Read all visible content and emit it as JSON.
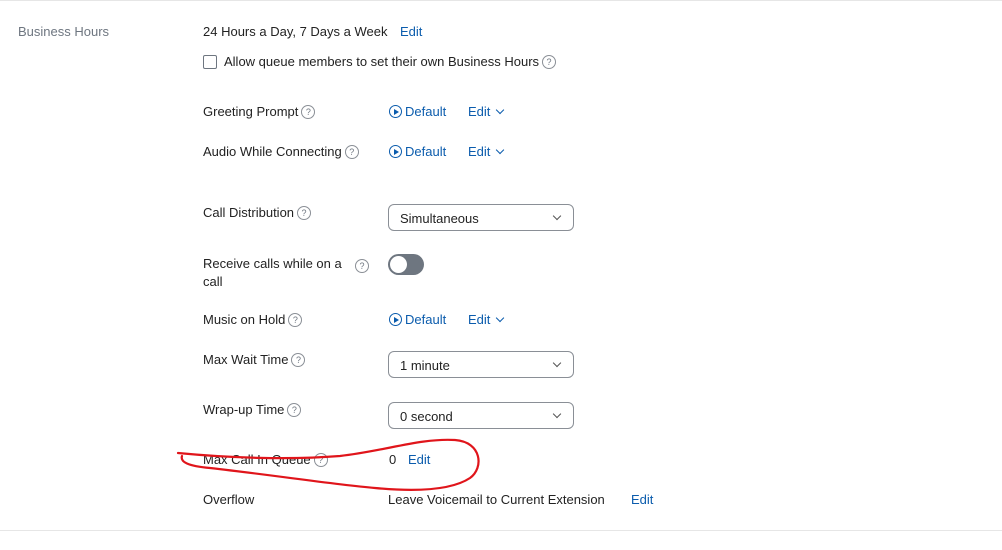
{
  "section": {
    "label": "Business Hours"
  },
  "business_hours": {
    "value": "24 Hours a Day, 7 Days a Week",
    "edit_label": "Edit",
    "allow_members_label": "Allow queue members to set their own Business Hours",
    "allow_members_checked": false
  },
  "greeting_prompt": {
    "label": "Greeting Prompt",
    "value": "Default",
    "edit_label": "Edit"
  },
  "audio_while_connecting": {
    "label": "Audio While Connecting",
    "value": "Default",
    "edit_label": "Edit"
  },
  "call_distribution": {
    "label": "Call Distribution",
    "selected": "Simultaneous"
  },
  "receive_calls": {
    "label_line1": "Receive calls while on a",
    "label_line2": "call",
    "enabled": false
  },
  "music_on_hold": {
    "label": "Music on Hold",
    "value": "Default",
    "edit_label": "Edit"
  },
  "max_wait_time": {
    "label": "Max Wait Time",
    "selected": "1 minute"
  },
  "wrap_up_time": {
    "label": "Wrap-up Time",
    "selected": "0 second"
  },
  "max_call_in_queue": {
    "label": "Max Call In Queue",
    "value": "0",
    "edit_label": "Edit"
  },
  "overflow": {
    "label": "Overflow",
    "value": "Leave Voicemail to Current Extension",
    "edit_label": "Edit"
  },
  "icons": {
    "help": "?",
    "play": "play-circle-icon",
    "chevron": "chevron-down-icon"
  },
  "colors": {
    "link": "#0b5cad",
    "annotation": "#e0151b",
    "toggle_off": "#6e7680"
  }
}
